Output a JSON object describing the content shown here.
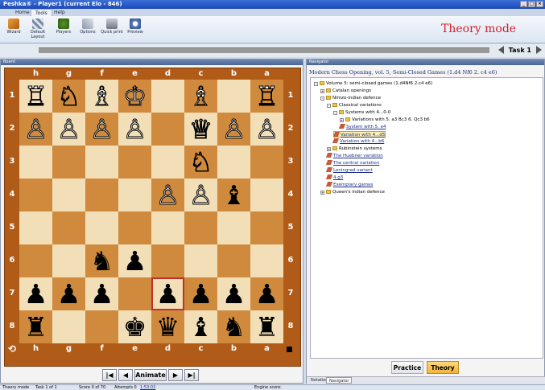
{
  "window": {
    "title": "Peshka® - Player1 (current Elo - 846)"
  },
  "ribbon": {
    "tabs": [
      "Home",
      "Tools",
      "Help"
    ],
    "active_tab": "Tools",
    "buttons": [
      "Wizard",
      "Default Layout",
      "Players",
      "Options",
      "Quick print",
      "Preview"
    ],
    "mode_title": "Theory mode"
  },
  "task": {
    "label": "Task 1"
  },
  "board": {
    "panel_title": "Board",
    "files": [
      "h",
      "g",
      "f",
      "e",
      "d",
      "c",
      "b",
      "a"
    ],
    "ranks": [
      "1",
      "2",
      "3",
      "4",
      "5",
      "6",
      "7",
      "8"
    ],
    "pieces": [
      [
        "wR",
        "wN",
        "wB",
        "wK",
        "",
        "wB",
        "",
        "wR"
      ],
      [
        "wP",
        "wP",
        "wP",
        "wP",
        "",
        "wQ",
        "wP",
        "wP"
      ],
      [
        "",
        "",
        "",
        "",
        "",
        "wN",
        "",
        ""
      ],
      [
        "",
        "",
        "",
        "",
        "wP",
        "wP",
        "bB",
        ""
      ],
      [
        "",
        "",
        "",
        "",
        "",
        "",
        "",
        ""
      ],
      [
        "",
        "",
        "bN",
        "bP",
        "",
        "",
        "",
        ""
      ],
      [
        "bP",
        "bP",
        "bP",
        "",
        "bP",
        "bP",
        "bP",
        "bP"
      ],
      [
        "bR",
        "",
        "",
        "bK",
        "bQ",
        "bB",
        "bN",
        "bR"
      ]
    ],
    "highlight": "d7",
    "animate_label": "Animate"
  },
  "navigator": {
    "panel_title": "Navigator",
    "header": "Modern Chess Opening, vol. 5, Semi-Closed Games (1.d4 Nf6 2. c4 e6)",
    "tree": [
      {
        "label": "Volume 5: semi-closed games (1.d4Nf6 2.c4 e6)",
        "level": 0,
        "type": "folder",
        "exp": "-"
      },
      {
        "label": "Catalan openings",
        "level": 1,
        "type": "folder",
        "exp": "+"
      },
      {
        "label": "Nimzo-indian defence",
        "level": 1,
        "type": "folder",
        "exp": "-"
      },
      {
        "label": "Classical variations",
        "level": 2,
        "type": "folder",
        "exp": "-"
      },
      {
        "label": "Systems with 4...0-0",
        "level": 3,
        "type": "folder",
        "exp": "-"
      },
      {
        "label": "Variations with 5. a3 Bc3 6. Qc3 b6",
        "level": 4,
        "type": "folder",
        "exp": "+"
      },
      {
        "label": "System with 5. e4",
        "level": 4,
        "type": "leaf",
        "exp": ""
      },
      {
        "label": "Variation with 4...d5",
        "level": 3,
        "type": "leaf",
        "exp": "",
        "selected": true
      },
      {
        "label": "Variation with 4...b6",
        "level": 3,
        "type": "leaf",
        "exp": ""
      },
      {
        "label": "Rubinstein systems",
        "level": 2,
        "type": "folder",
        "exp": "+"
      },
      {
        "label": "The Huebner variation",
        "level": 2,
        "type": "leaf",
        "exp": ""
      },
      {
        "label": "The central variation",
        "level": 2,
        "type": "leaf",
        "exp": ""
      },
      {
        "label": "Leningrad variant",
        "level": 2,
        "type": "leaf",
        "exp": ""
      },
      {
        "label": "4.g3",
        "level": 2,
        "type": "leaf",
        "exp": ""
      },
      {
        "label": "Exemplary games",
        "level": 2,
        "type": "leaf",
        "exp": ""
      },
      {
        "label": "Queen's indian defence",
        "level": 1,
        "type": "folder",
        "exp": "+"
      }
    ],
    "practice_label": "Practice",
    "theory_label": "Theory",
    "tabs": [
      "Notation",
      "Navigator"
    ],
    "active_tab": "Navigator"
  },
  "status": {
    "mode": "Theory mode",
    "task": "Task 1 of 1",
    "score": "Score 0 of 70",
    "attempts": "Attempts 0",
    "time": "1:53:02",
    "engine": "Engine score:"
  },
  "colors": {
    "light_square": "#f3dfb7",
    "dark_square": "#cf8a3d",
    "board_frame": "#b05b18",
    "mode_title": "#d1202a",
    "theory_button": "#f2b43a"
  }
}
